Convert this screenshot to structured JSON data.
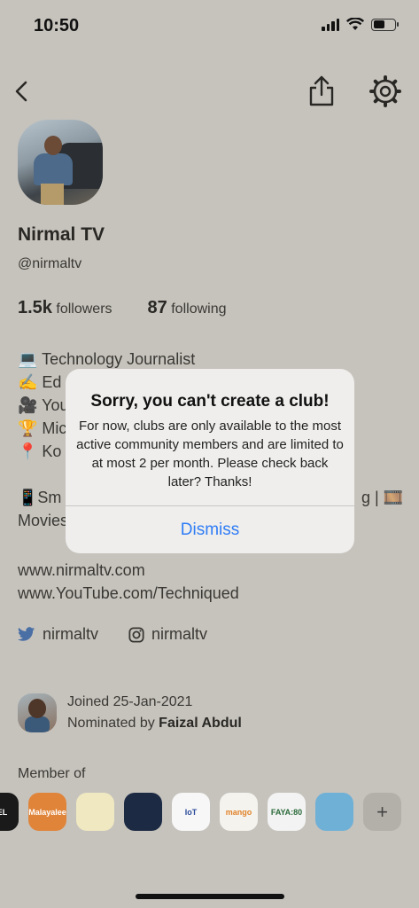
{
  "status_bar": {
    "time": "10:50"
  },
  "profile": {
    "name": "Nirmal TV",
    "handle": "@nirmaltv",
    "followers_count": "1.5k",
    "followers_label": "followers",
    "following_count": "87",
    "following_label": "following",
    "bio_lines": [
      "💻 Technology Journalist",
      "✍️ Ed",
      "🎥 You",
      "🏆 Mic",
      "📍 Ko"
    ],
    "bio_extra_row1_left": "📱Sm",
    "bio_extra_row1_right": "g | 🎞️",
    "bio_extra_row2": "Movies",
    "links": [
      "www.nirmaltv.com",
      "www.YouTube.com/Techniqued"
    ],
    "twitter": "nirmaltv",
    "instagram": "nirmaltv",
    "joined": "Joined 25-Jan-2021",
    "nominated_prefix": "Nominated by ",
    "nominated_by": "Faizal Abdul"
  },
  "member_of": {
    "title": "Member of",
    "clubs": [
      {
        "label": "XEL",
        "bg": "#1a1a1a",
        "fg": "#ffffff"
      },
      {
        "label": "Malayalee",
        "bg": "#e0843a",
        "fg": "#ffffff"
      },
      {
        "label": "",
        "bg": "#f0e8c0",
        "fg": "#333333"
      },
      {
        "label": "",
        "bg": "#1d2a44",
        "fg": "#ffffff"
      },
      {
        "label": "IoT",
        "bg": "#f7f7f7",
        "fg": "#2a4a9a"
      },
      {
        "label": "mango",
        "bg": "#f5f3ee",
        "fg": "#e0832a"
      },
      {
        "label": "FAYA:80",
        "bg": "#f3f3f3",
        "fg": "#2b6a3a"
      },
      {
        "label": "",
        "bg": "#6fb0d6",
        "fg": "#ffffff"
      }
    ],
    "add_label": "+"
  },
  "alert": {
    "title": "Sorry, you can't create a club!",
    "message": "For now, clubs are only available to the most active community members and are limited to at most 2 per month. Please check back later? Thanks!",
    "button": "Dismiss"
  },
  "colors": {
    "background": "#c6c3bd",
    "alert_bg": "#efeeec",
    "link_blue": "#2f7cf6"
  }
}
